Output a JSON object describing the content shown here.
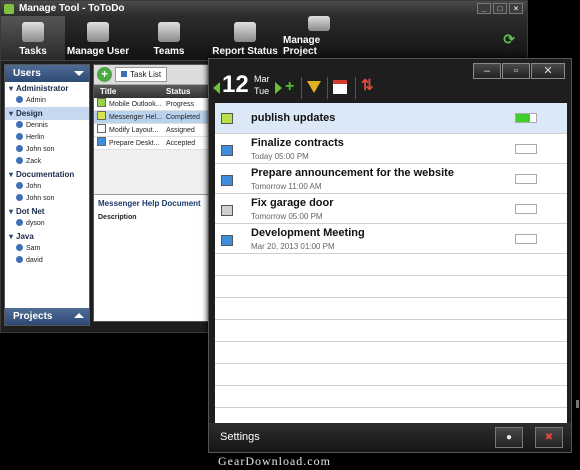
{
  "manage_tool": {
    "title": "Manage Tool - ToToDo",
    "toolbar": [
      {
        "label": "Tasks",
        "icon": "tasks-icon"
      },
      {
        "label": "Manage User",
        "icon": "manage-user-icon"
      },
      {
        "label": "Teams",
        "icon": "teams-icon"
      },
      {
        "label": "Report Status",
        "icon": "report-status-icon"
      },
      {
        "label": "Manage Project",
        "icon": "manage-project-icon"
      }
    ],
    "users_header": "Users",
    "projects_header": "Projects",
    "groups": [
      {
        "name": "Administrator",
        "users": [
          "Admin"
        ]
      },
      {
        "name": "Design",
        "users": [
          "Dennis",
          "Herlin",
          "John son",
          "Zack"
        ]
      },
      {
        "name": "Documentation",
        "users": [
          "John",
          "John son"
        ]
      },
      {
        "name": "Dot Net",
        "users": [
          "dyson"
        ]
      },
      {
        "name": "Java",
        "users": [
          "Sam",
          "david"
        ]
      }
    ],
    "task_list": {
      "tab_label": "Task List",
      "headers": [
        "Title",
        "Status"
      ],
      "rows": [
        {
          "title": "Mobile Outlook...",
          "status": "Progress",
          "color": "#9ad14b"
        },
        {
          "title": "Messenger Hel...",
          "status": "Completed",
          "color": "#d7e64a"
        },
        {
          "title": "Modify Layout...",
          "status": "Assigned",
          "color": "#ffffff"
        },
        {
          "title": "Prepare Deskt...",
          "status": "Accepted",
          "color": "#3e8ee0"
        }
      ],
      "detail_title": "Messenger Help Document",
      "detail_label": "Description"
    }
  },
  "totodo": {
    "date": {
      "day": "12",
      "month": "Mar",
      "weekday": "Tue"
    },
    "tasks": [
      {
        "title": "publish updates",
        "due": "",
        "checkbox_color": "#b7e04a",
        "progress": 0.7
      },
      {
        "title": "Finalize contracts",
        "due": "Today 05:00 PM",
        "checkbox_color": "#3e8ee0",
        "progress": 0
      },
      {
        "title": "Prepare announcement for the website",
        "due": "Tomorrow 11:00 AM",
        "checkbox_color": "#3e8ee0",
        "progress": 0
      },
      {
        "title": "Fix garage door",
        "due": "Tomorrow 05:00 PM",
        "checkbox_color": "#cfcfcf",
        "progress": 0
      },
      {
        "title": "Development Meeting",
        "due": "Mar 20, 2013 01:00 PM",
        "checkbox_color": "#3e8ee0",
        "progress": 0
      }
    ],
    "settings_label": "Settings"
  },
  "watermark": "GearDownload.com"
}
